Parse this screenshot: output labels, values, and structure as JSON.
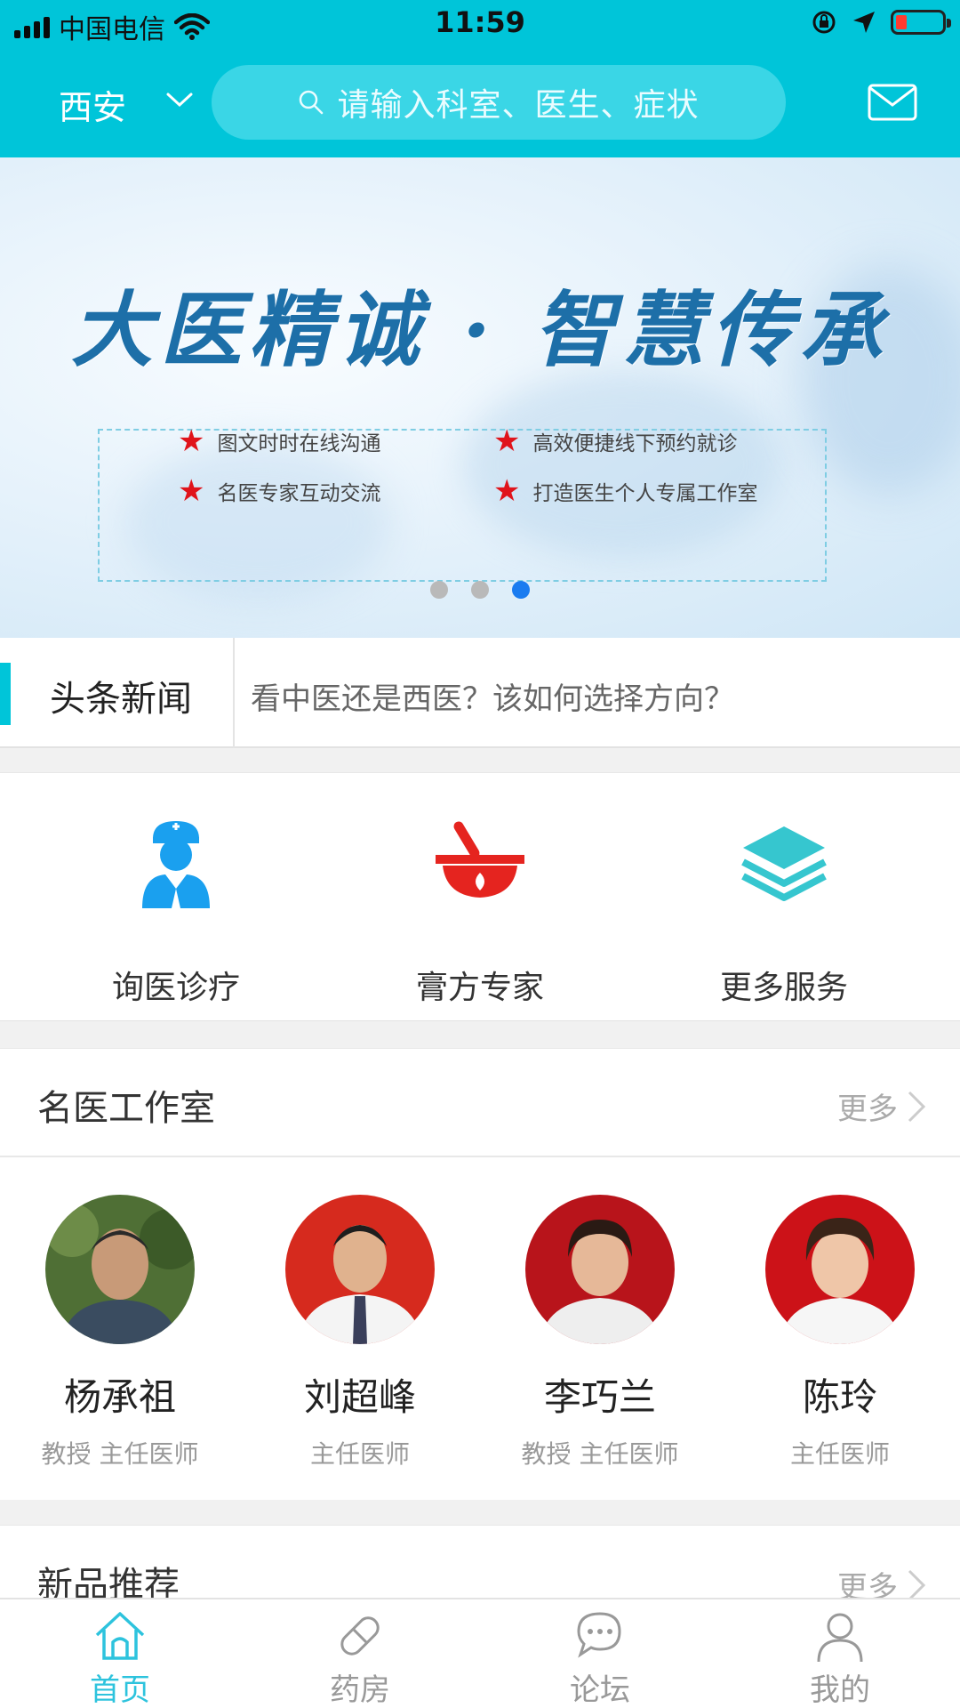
{
  "status_bar": {
    "carrier": "中国电信",
    "time": "11:59"
  },
  "header": {
    "city": "西安",
    "search_placeholder": "请输入科室、医生、症状",
    "icons": [
      "chevron-down-icon",
      "search-icon",
      "mail-icon"
    ]
  },
  "banner": {
    "title": "大医精诚 · 智慧传承",
    "features": [
      "图文时时在线沟通",
      "高效便捷线下预约就诊",
      "名医专家互动交流",
      "打造医生个人专属工作室"
    ],
    "page_count": 3,
    "active_page": 3
  },
  "news": {
    "label": "头条新闻",
    "headline": "看中医还是西医？该如何选择方向？"
  },
  "services": [
    {
      "label": "询医诊疗",
      "icon": "doctor-icon",
      "color": "#1aa0ef"
    },
    {
      "label": "膏方专家",
      "icon": "mortar-icon",
      "color": "#e5241f"
    },
    {
      "label": "更多服务",
      "icon": "layers-icon",
      "color": "#36c6cf"
    }
  ],
  "famous_doctors": {
    "title": "名医工作室",
    "more": "更多",
    "doctors": [
      {
        "name": "杨承祖",
        "title": "教授 主任医师"
      },
      {
        "name": "刘超峰",
        "title": "主任医师"
      },
      {
        "name": "李巧兰",
        "title": "教授 主任医师"
      },
      {
        "name": "陈玲",
        "title": "主任医师"
      }
    ]
  },
  "new_products": {
    "title": "新品推荐",
    "more": "更多"
  },
  "tabbar": {
    "tabs": [
      {
        "label": "首页",
        "icon": "home-icon",
        "active": true
      },
      {
        "label": "药房",
        "icon": "pill-icon",
        "active": false
      },
      {
        "label": "论坛",
        "icon": "chat-icon",
        "active": false
      },
      {
        "label": "我的",
        "icon": "user-icon",
        "active": false
      }
    ]
  },
  "colors": {
    "brand": "#00c5d9",
    "active_tab": "#2dc3dd",
    "star": "#e0141b",
    "active_dot": "#1a7cf0"
  }
}
